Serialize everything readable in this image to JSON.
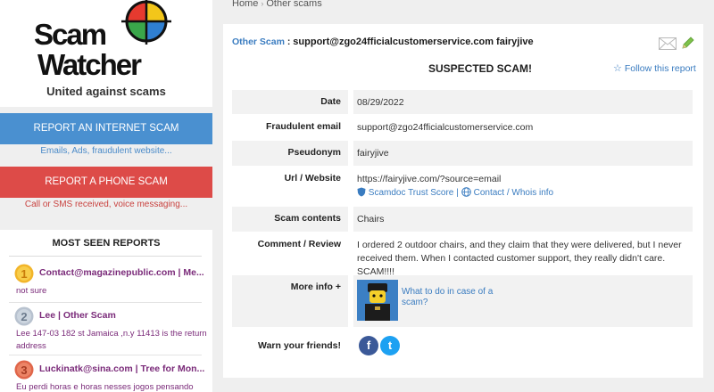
{
  "logo": {
    "line1": "Scam",
    "line2": "Watcher"
  },
  "tagline": "United against scams",
  "cta": {
    "internet": {
      "label": "REPORT AN INTERNET SCAM",
      "sub": "Emails, Ads, fraudulent website..."
    },
    "phone": {
      "label": "REPORT A PHONE SCAM",
      "sub": "Call or SMS received, voice messaging..."
    }
  },
  "most_seen": {
    "title": "MOST SEEN REPORTS",
    "items": [
      {
        "rank": "1",
        "title": "Contact@magazinepublic.com | Me...",
        "desc": "not sure"
      },
      {
        "rank": "2",
        "title": "Lee | Other Scam",
        "desc": "Lee 147-03 182 st Jamaica ,n.y 11413 is the return address"
      },
      {
        "rank": "3",
        "title": "Luckinatk@sina.com | Tree for Mon...",
        "desc": "Eu perdi horas e horas nesses jogos pensando"
      }
    ]
  },
  "breadcrumb": {
    "home": "Home",
    "current": "Other scams"
  },
  "report": {
    "category": "Other Scam",
    "separator": ":",
    "subject": "support@zgo24fficialcustomerservice.com fairyjive",
    "status": "SUSPECTED SCAM!",
    "follow": "Follow this report",
    "rows": {
      "date": {
        "label": "Date",
        "value": "08/29/2022"
      },
      "email": {
        "label": "Fraudulent email",
        "value": "support@zgo24fficialcustomerservice.com"
      },
      "pseudonym": {
        "label": "Pseudonym",
        "value": "fairyjive"
      },
      "url": {
        "label": "Url / Website",
        "value": "https://fairyjive.com/?source=email",
        "trust": "Scamdoc Trust Score",
        "bar": "|",
        "whois": "Contact / Whois info"
      },
      "contents": {
        "label": "Scam contents",
        "value": "Chairs"
      },
      "comment": {
        "label": "Comment / Review",
        "value": "I ordered 2 outdoor chairs, and they claim that they were delivered, but I never received them. When I contacted customer support, they really didn't care. SCAM!!!!"
      },
      "more": {
        "label": "More info +",
        "link": "What to do in case of a scam?"
      },
      "warn": {
        "label": "Warn your friends!",
        "fb": "f",
        "tw": "t"
      }
    }
  },
  "colors": {
    "accent_blue": "#3a7cc0",
    "report_blue": "#4a90d0",
    "report_red": "#dd4b48",
    "purple_link": "#7a2a79"
  }
}
